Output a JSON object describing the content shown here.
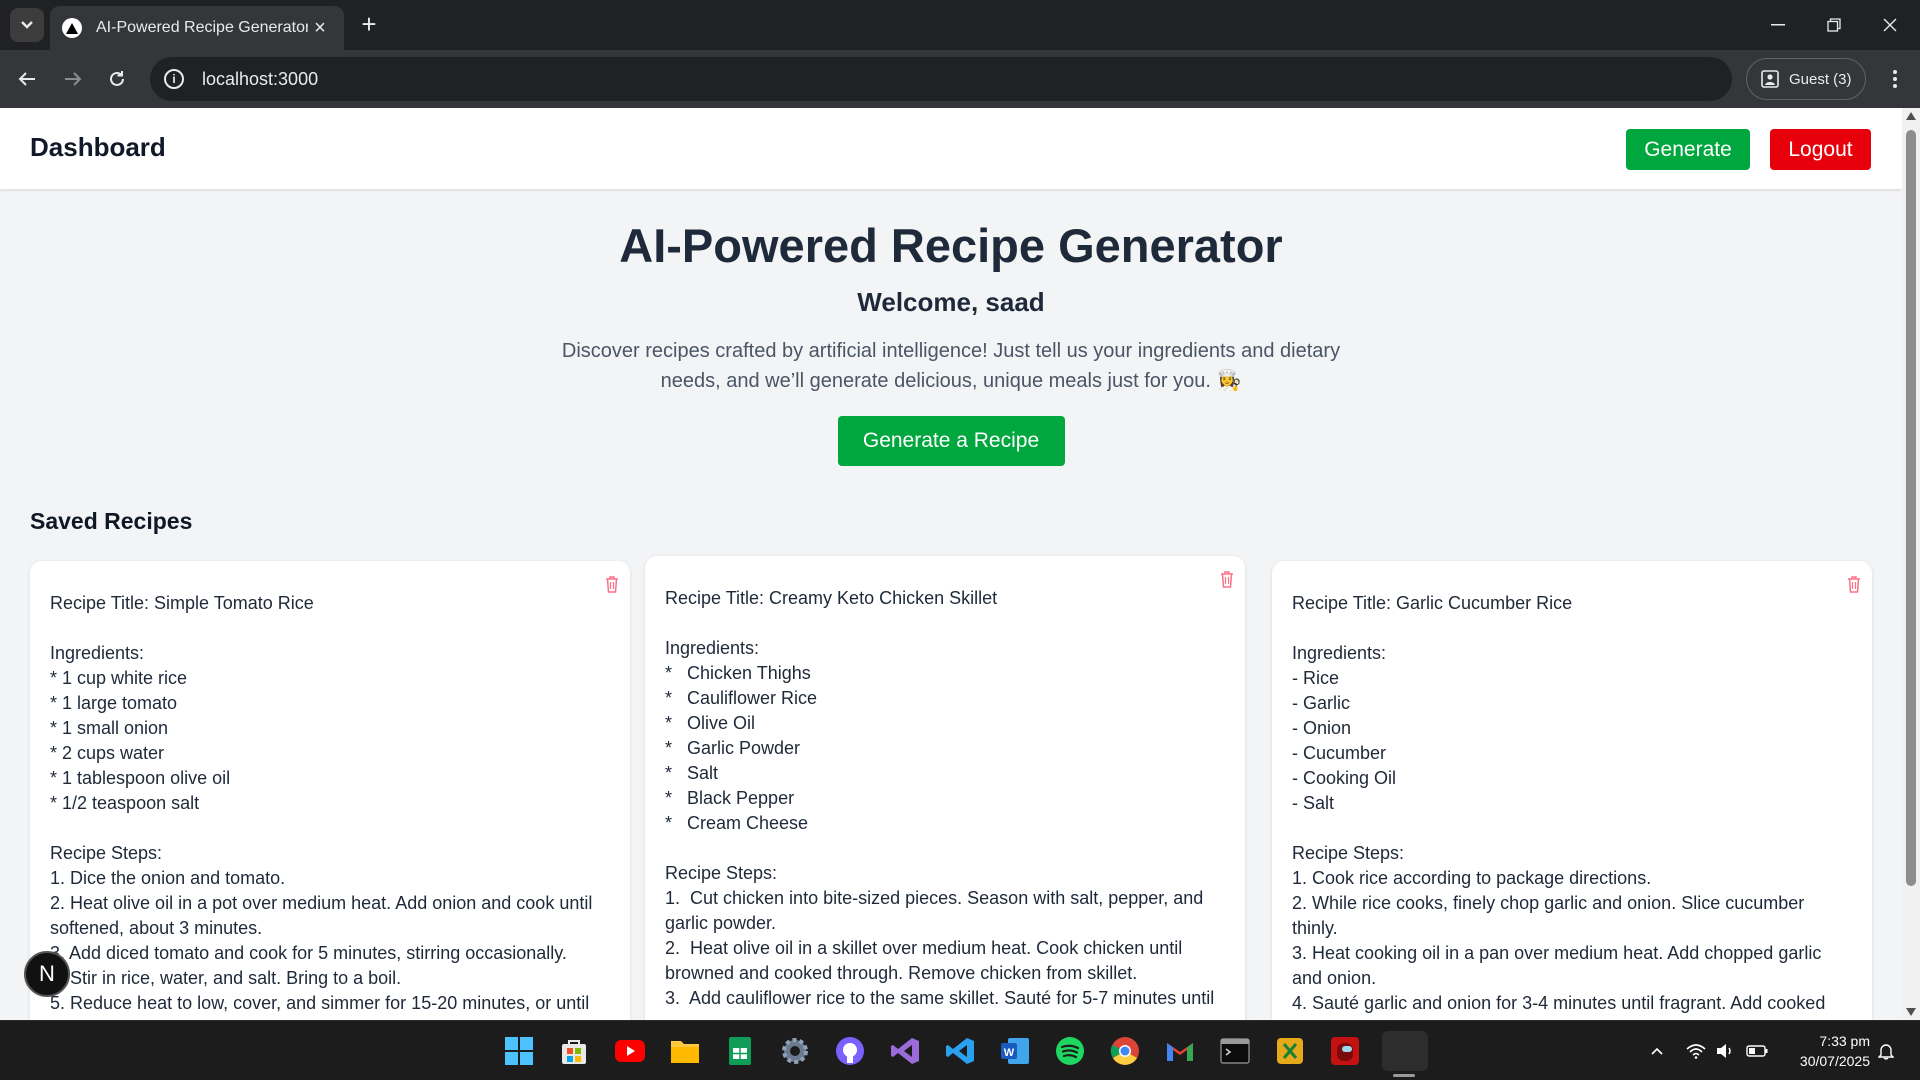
{
  "browser": {
    "tab_title": "AI-Powered Recipe Generator",
    "url": "localhost:3000",
    "profile_label": "Guest (3)"
  },
  "navbar": {
    "brand": "Dashboard",
    "generate_label": "Generate",
    "logout_label": "Logout"
  },
  "hero": {
    "title": "AI-Powered Recipe Generator",
    "welcome": "Welcome, saad",
    "description": "Discover recipes crafted by artificial intelligence! Just tell us your ingredients and dietary needs, and we’ll generate delicious, unique meals just for you. 👩‍🍳",
    "cta_label": "Generate a Recipe"
  },
  "saved": {
    "heading": "Saved Recipes",
    "recipes": [
      {
        "text": "Recipe Title: Simple Tomato Rice\n\nIngredients:\n* 1 cup white rice\n* 1 large tomato\n* 1 small onion\n* 2 cups water\n* 1 tablespoon olive oil\n* 1/2 teaspoon salt\n\nRecipe Steps:\n1. Dice the onion and tomato.\n2. Heat olive oil in a pot over medium heat. Add onion and cook until softened, about 3 minutes.\n3. Add diced tomato and cook for 5 minutes, stirring occasionally.\n4. Stir in rice, water, and salt. Bring to a boil.\n5. Reduce heat to low, cover, and simmer for 15-20 minutes, or until"
      },
      {
        "text": "Recipe Title: Creamy Keto Chicken Skillet\n\nIngredients:\n*   Chicken Thighs\n*   Cauliflower Rice\n*   Olive Oil\n*   Garlic Powder\n*   Salt\n*   Black Pepper\n*   Cream Cheese\n\nRecipe Steps:\n1.  Cut chicken into bite-sized pieces. Season with salt, pepper, and garlic powder.\n2.  Heat olive oil in a skillet over medium heat. Cook chicken until browned and cooked through. Remove chicken from skillet.\n3.  Add cauliflower rice to the same skillet. Sauté for 5-7 minutes until"
      },
      {
        "text": "Recipe Title: Garlic Cucumber Rice\n\nIngredients:\n- Rice\n- Garlic\n- Onion\n- Cucumber\n- Cooking Oil\n- Salt\n\nRecipe Steps:\n1. Cook rice according to package directions.\n2. While rice cooks, finely chop garlic and onion. Slice cucumber thinly.\n3. Heat cooking oil in a pan over medium heat. Add chopped garlic and onion.\n4. Sauté garlic and onion for 3-4 minutes until fragrant. Add cooked rice and salt."
      }
    ]
  },
  "dev_badge": "N",
  "taskbar": {
    "time": "7:33 pm",
    "date": "30/07/2025"
  },
  "colors": {
    "green": "#00a63e",
    "red": "#e7000b",
    "page_bg": "#f3f4f6"
  }
}
